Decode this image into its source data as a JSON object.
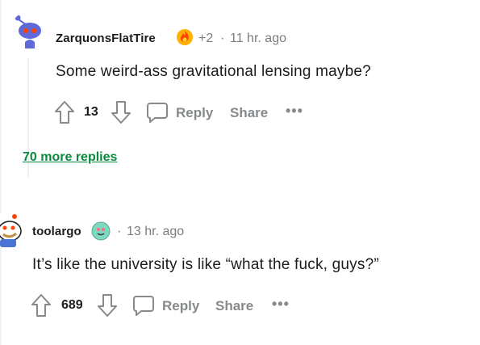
{
  "comments": [
    {
      "username": "ZarquonsFlatTire",
      "flair_icon": "fire-flair-icon",
      "score_delta": "+2",
      "separator": "·",
      "time": "11 hr. ago",
      "body": "Some weird-ass gravitational lensing maybe?",
      "votes": "13",
      "reply_label": "Reply",
      "share_label": "Share",
      "more_label": "•••"
    },
    {
      "username": "toolargo",
      "flair_icon": "snoo-flair-icon",
      "separator": "·",
      "time": "13 hr. ago",
      "body": "It’s like the university is like “what the fuck, guys?”",
      "votes": "689",
      "reply_label": "Reply",
      "share_label": "Share",
      "more_label": "•••"
    }
  ],
  "more_replies": "70 more replies",
  "colors": {
    "link_green": "#0a8a3e",
    "muted": "#878a8c",
    "snoo_blue": "#5f6ad8",
    "snoo_red": "#ff4500"
  }
}
